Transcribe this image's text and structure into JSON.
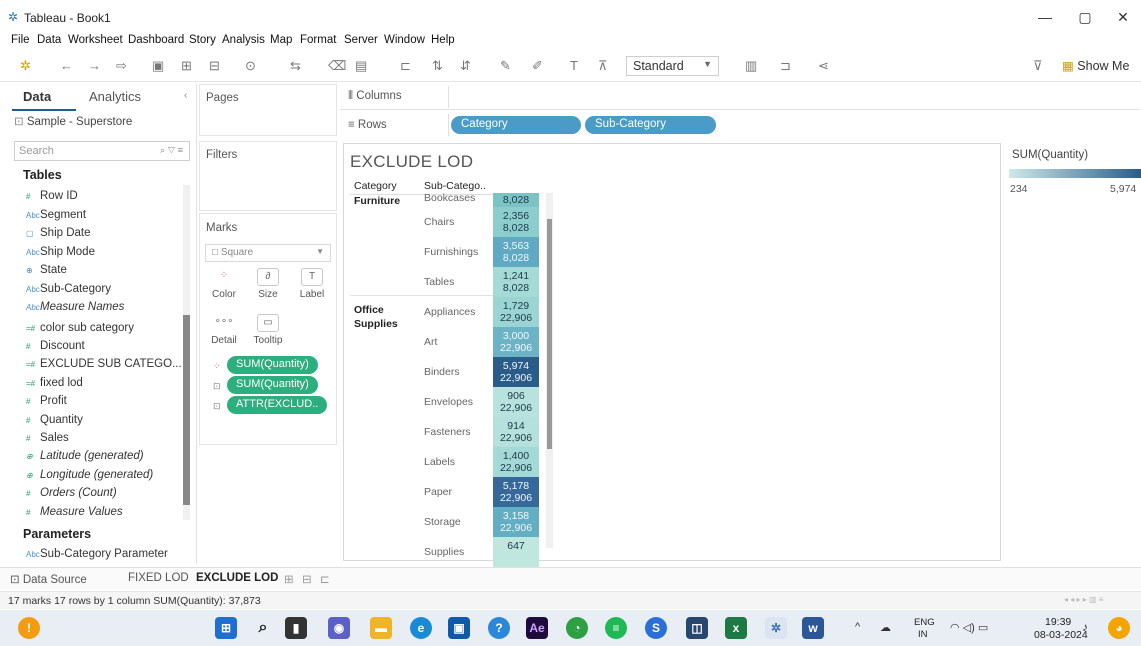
{
  "window": {
    "title": "Tableau - Book1",
    "minimize": "—",
    "restore": "▢",
    "close": "✕"
  },
  "menu": [
    "File",
    "Data",
    "Worksheet",
    "Dashboard",
    "Story",
    "Analysis",
    "Map",
    "Format",
    "Server",
    "Window",
    "Help"
  ],
  "toolbar": {
    "fit_select": "Standard",
    "show_me": "Show Me"
  },
  "data_pane": {
    "tabs": {
      "data": "Data",
      "analytics": "Analytics"
    },
    "datasource": "Sample - Superstore",
    "search_placeholder": "Search",
    "tables_header": "Tables",
    "fields": [
      {
        "label": "Row ID",
        "kind": "measure",
        "icon": "#",
        "italic": false
      },
      {
        "label": "Segment",
        "kind": "dim",
        "icon": "Abc",
        "italic": false
      },
      {
        "label": "Ship Date",
        "kind": "dim",
        "icon": "▢",
        "italic": false
      },
      {
        "label": "Ship Mode",
        "kind": "dim",
        "icon": "Abc",
        "italic": false
      },
      {
        "label": "State",
        "kind": "dim",
        "icon": "⊕",
        "italic": false
      },
      {
        "label": "Sub-Category",
        "kind": "dim",
        "icon": "Abc",
        "italic": false
      },
      {
        "label": "Measure Names",
        "kind": "dim",
        "icon": "Abc",
        "italic": true
      },
      {
        "label": "color sub category",
        "kind": "measure",
        "icon": "=#",
        "italic": false
      },
      {
        "label": "Discount",
        "kind": "measure",
        "icon": "#",
        "italic": false
      },
      {
        "label": "EXCLUDE SUB CATEGO...",
        "kind": "measure",
        "icon": "=#",
        "italic": false
      },
      {
        "label": "fixed lod",
        "kind": "measure",
        "icon": "=#",
        "italic": false
      },
      {
        "label": "Profit",
        "kind": "measure",
        "icon": "#",
        "italic": false
      },
      {
        "label": "Quantity",
        "kind": "measure",
        "icon": "#",
        "italic": false
      },
      {
        "label": "Sales",
        "kind": "measure",
        "icon": "#",
        "italic": false
      },
      {
        "label": "Latitude (generated)",
        "kind": "measure",
        "icon": "⊕",
        "italic": true
      },
      {
        "label": "Longitude (generated)",
        "kind": "measure",
        "icon": "⊕",
        "italic": true
      },
      {
        "label": "Orders (Count)",
        "kind": "measure",
        "icon": "#",
        "italic": true
      },
      {
        "label": "Measure Values",
        "kind": "measure",
        "icon": "#",
        "italic": true
      }
    ],
    "parameters_header": "Parameters",
    "parameter": "Sub-Category Parameter"
  },
  "cards": {
    "pages": "Pages",
    "filters": "Filters",
    "marks": "Marks",
    "mark_type": "Square",
    "mark_buttons": [
      "Color",
      "Size",
      "Label",
      "Detail",
      "Tooltip"
    ],
    "mark_pills": [
      "SUM(Quantity)",
      "SUM(Quantity)",
      "ATTR(EXCLUD.."
    ]
  },
  "shelves": {
    "columns": "Columns",
    "rows": "Rows",
    "row_pills": [
      "Category",
      "Sub-Category"
    ]
  },
  "view": {
    "sheet_title": "EXCLUDE LOD",
    "header_category": "Category",
    "header_subcategory": "Sub-Catego..",
    "categories": [
      {
        "label": "Furniture"
      },
      {
        "label": "Office Supplies"
      }
    ],
    "rows": [
      {
        "sub": "Bookcases",
        "qty": "",
        "excl": "8,028",
        "color": "#7cc3c6",
        "light": false
      },
      {
        "sub": "Chairs",
        "qty": "2,356",
        "excl": "8,028",
        "color": "#8ccdcd",
        "light": false
      },
      {
        "sub": "Furnishings",
        "qty": "3,563",
        "excl": "8,028",
        "color": "#5fa9c2",
        "light": true
      },
      {
        "sub": "Tables",
        "qty": "1,241",
        "excl": "8,028",
        "color": "#a6dad7",
        "light": false
      },
      {
        "sub": "Appliances",
        "qty": "1,729",
        "excl": "22,906",
        "color": "#9ad4d3",
        "light": false
      },
      {
        "sub": "Art",
        "qty": "3,000",
        "excl": "22,906",
        "color": "#6db3c6",
        "light": true
      },
      {
        "sub": "Binders",
        "qty": "5,974",
        "excl": "22,906",
        "color": "#2a5c8a",
        "light": true
      },
      {
        "sub": "Envelopes",
        "qty": "906",
        "excl": "22,906",
        "color": "#b7e2dd",
        "light": false
      },
      {
        "sub": "Fasteners",
        "qty": "914",
        "excl": "22,906",
        "color": "#b5e1dc",
        "light": false
      },
      {
        "sub": "Labels",
        "qty": "1,400",
        "excl": "22,906",
        "color": "#a3d9d6",
        "light": false
      },
      {
        "sub": "Paper",
        "qty": "5,178",
        "excl": "22,906",
        "color": "#36689a",
        "light": true
      },
      {
        "sub": "Storage",
        "qty": "3,158",
        "excl": "22,906",
        "color": "#64aec4",
        "light": true
      },
      {
        "sub": "Supplies",
        "qty": "647",
        "excl": "",
        "color": "#c0e6e0",
        "light": false
      }
    ],
    "legend": {
      "title": "SUM(Quantity)",
      "min": "234",
      "max": "5,974",
      "color_low": "#cfe9ea",
      "color_high": "#2a5c8a"
    }
  },
  "sheet_tabs": {
    "datasource": "Data Source",
    "tabs": [
      "FIXED LOD",
      "EXCLUDE LOD"
    ],
    "active": "EXCLUDE LOD"
  },
  "status": "17 marks    17 rows by 1 column    SUM(Quantity): 37,873",
  "taskbar": {
    "lang1": "ENG",
    "lang2": "IN",
    "time": "19:39",
    "date": "08-03-2024"
  }
}
